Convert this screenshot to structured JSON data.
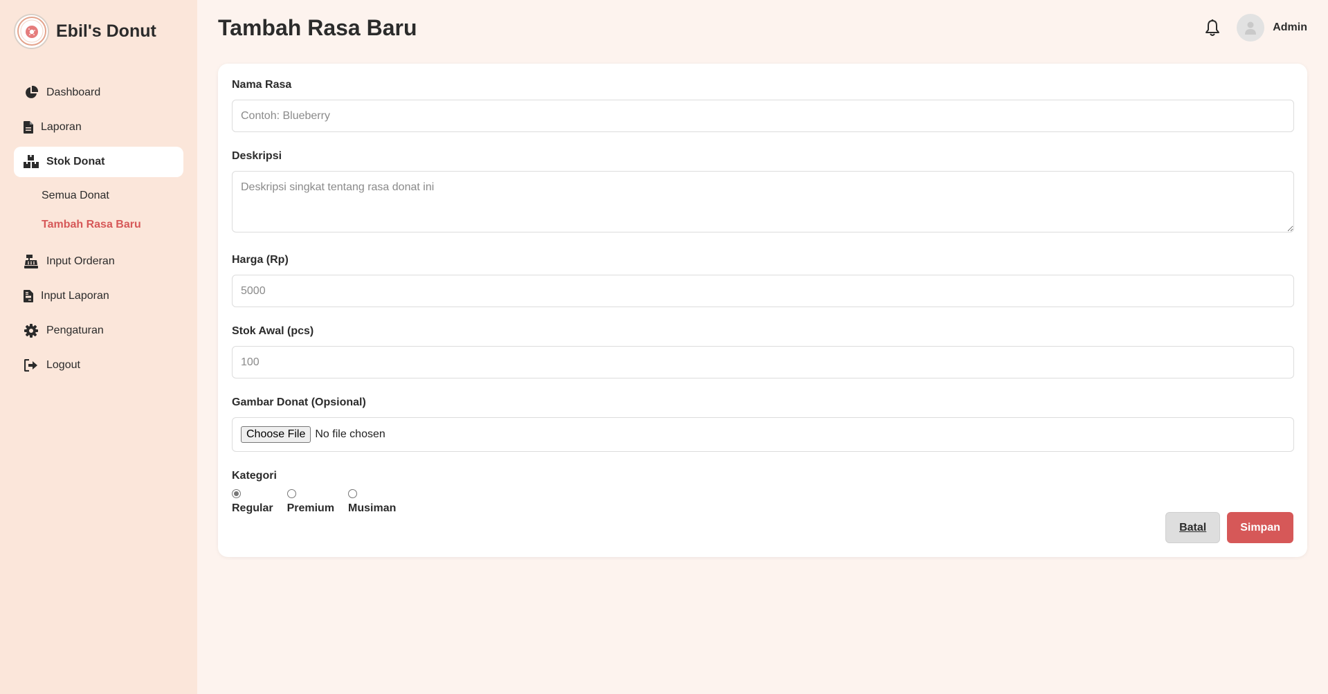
{
  "brand": {
    "name": "Ebil's Donut",
    "logo_text": "EBIL'S DONUT"
  },
  "sidebar": {
    "items": [
      {
        "label": "Dashboard",
        "icon": "pie-chart-icon"
      },
      {
        "label": "Laporan",
        "icon": "file-icon"
      },
      {
        "label": "Stok Donat",
        "icon": "boxes-icon",
        "active": true
      },
      {
        "label": "Input Orderan",
        "icon": "cash-register-icon"
      },
      {
        "label": "Input Laporan",
        "icon": "file-invoice-icon"
      },
      {
        "label": "Pengaturan",
        "icon": "gear-icon"
      },
      {
        "label": "Logout",
        "icon": "logout-icon"
      }
    ],
    "subitems": [
      {
        "label": "Semua Donat"
      },
      {
        "label": "Tambah Rasa Baru",
        "active": true
      }
    ]
  },
  "header": {
    "title": "Tambah Rasa Baru",
    "user": "Admin"
  },
  "form": {
    "nama": {
      "label": "Nama Rasa",
      "placeholder": "Contoh: Blueberry",
      "value": ""
    },
    "deskripsi": {
      "label": "Deskripsi",
      "placeholder": "Deskripsi singkat tentang rasa donat ini",
      "value": ""
    },
    "harga": {
      "label": "Harga (Rp)",
      "placeholder": "5000",
      "value": ""
    },
    "stok": {
      "label": "Stok Awal (pcs)",
      "placeholder": "100",
      "value": ""
    },
    "gambar": {
      "label": "Gambar Donat (Opsional)",
      "button": "Choose File",
      "status": "No file chosen"
    },
    "kategori": {
      "label": "Kategori",
      "options": [
        "Regular",
        "Premium",
        "Musiman"
      ],
      "selected": "Regular"
    },
    "actions": {
      "cancel": "Batal",
      "save": "Simpan"
    }
  },
  "colors": {
    "accent": "#d65858",
    "sidebar_bg": "#fbe6da",
    "page_bg": "#fdf3ee"
  }
}
